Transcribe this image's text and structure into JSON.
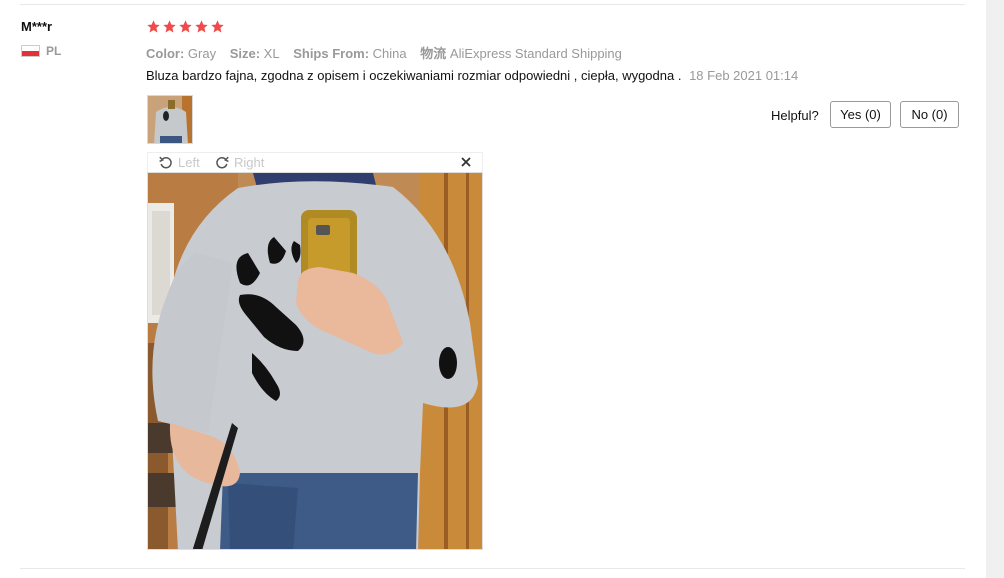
{
  "reviewer": {
    "name": "M***r",
    "country_code": "PL",
    "flag_icon": "poland-flag-icon"
  },
  "rating": {
    "stars": 5,
    "max": 5,
    "color": "#f04b4b"
  },
  "attributes": [
    {
      "label": "Color:",
      "value": "Gray"
    },
    {
      "label": "Size:",
      "value": "XL"
    },
    {
      "label": "Ships From:",
      "value": "China"
    },
    {
      "label": "物流",
      "value": "AliExpress Standard Shipping"
    }
  ],
  "review": {
    "text": "Bluza bardzo fajna, zgodna z opisem i oczekiwaniami rozmiar odpowiedni , ciepła, wygodna .",
    "date": "18 Feb 2021 01:14"
  },
  "helpful": {
    "label": "Helpful?",
    "yes": "Yes (0)",
    "no": "No (0)"
  },
  "viewer": {
    "rotate_left": "Left",
    "rotate_right": "Right",
    "close_icon": "close-icon"
  }
}
